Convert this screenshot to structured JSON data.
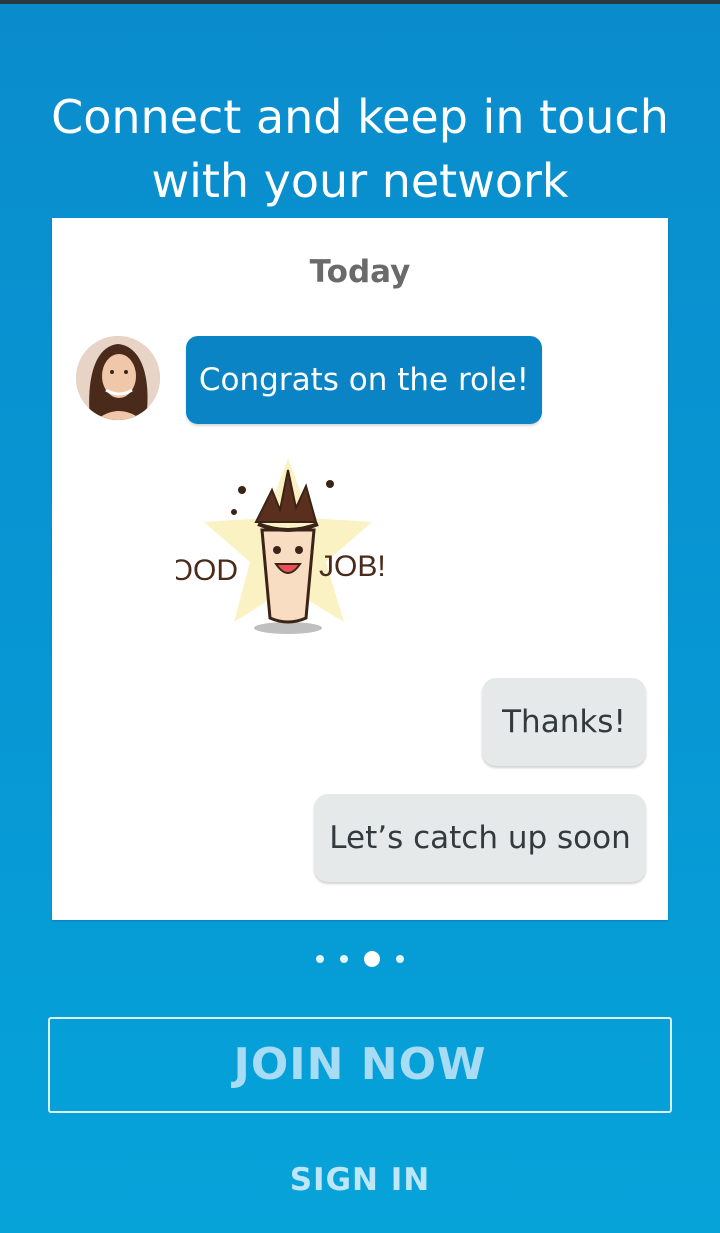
{
  "headline": {
    "line1": "Connect and keep in touch",
    "line2": "with your network"
  },
  "conversation": {
    "day_label": "Today",
    "incoming_message": "Congrats on the role!",
    "sticker": {
      "left_word": "GOOD",
      "right_word": "JOB!"
    },
    "outgoing_messages": [
      "Thanks!",
      "Let’s catch up soon"
    ]
  },
  "pager": {
    "total_pages": 4,
    "active_page": 3
  },
  "actions": {
    "join_label": "JOIN NOW",
    "signin_label": "SIGN IN"
  },
  "colors": {
    "background": "#0797d4",
    "bubble_blue": "#0b84c6",
    "bubble_grey": "#e6e9ea"
  }
}
